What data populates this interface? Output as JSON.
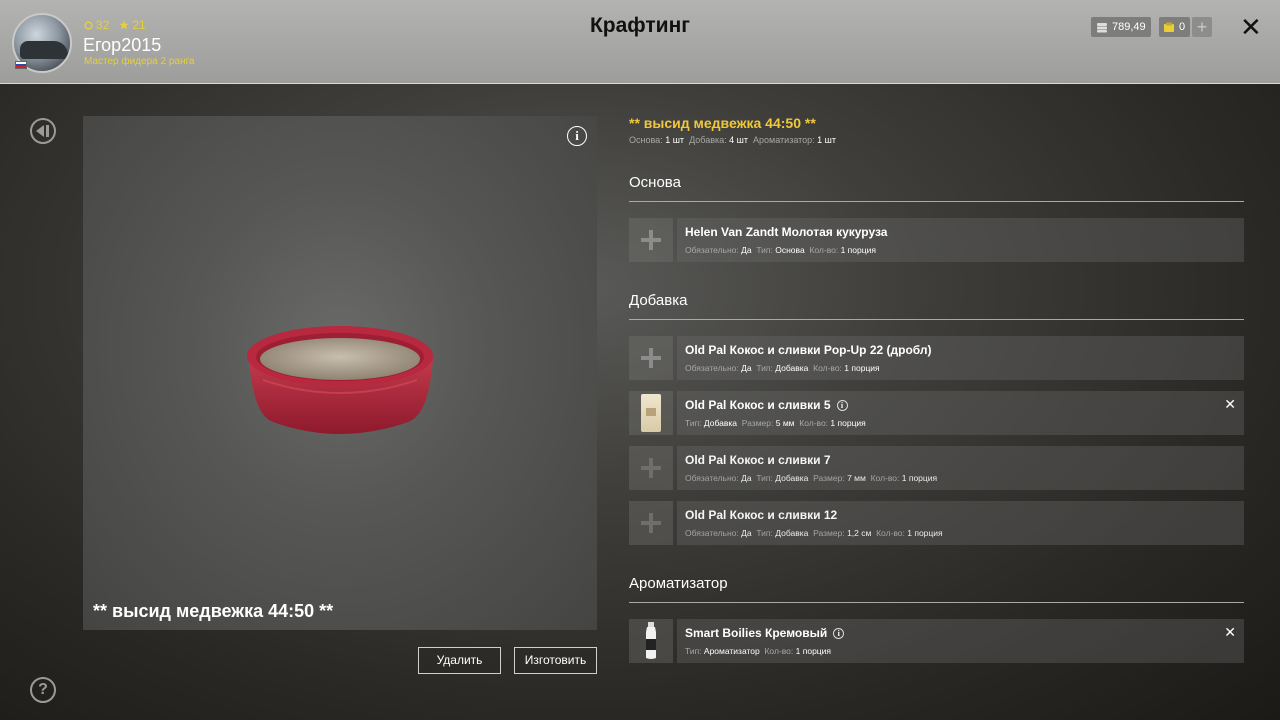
{
  "header": {
    "title": "Крафтинг",
    "username": "Егор2015",
    "rank": "Мастер фидера 2 ранга",
    "level": "32",
    "stars": "21",
    "money": "789,49",
    "gold": "0"
  },
  "preview": {
    "name": "** высид медвежка 44:50 **",
    "delete_label": "Удалить",
    "make_label": "Изготовить"
  },
  "recipe": {
    "title": "** высид медвежка 44:50 **",
    "summary": {
      "base_label": "Основа:",
      "base_value": "1 шт",
      "additive_label": "Добавка:",
      "additive_value": "4 шт",
      "flavor_label": "Ароматизатор:",
      "flavor_value": "1 шт"
    }
  },
  "sections": {
    "base": {
      "title": "Основа",
      "items": [
        {
          "name": "Helen Van Zandt Молотая кукуруза",
          "req_label": "Обязательно:",
          "req": "Да",
          "type_label": "Тип:",
          "type": "Основа",
          "qty_label": "Кол-во:",
          "qty": "1 порция"
        }
      ]
    },
    "additive": {
      "title": "Добавка",
      "items": [
        {
          "name": "Old Pal Кокос и сливки Pop-Up 22 (дробл)",
          "req_label": "Обязательно:",
          "req": "Да",
          "type_label": "Тип:",
          "type": "Добавка",
          "qty_label": "Кол-во:",
          "qty": "1 порция"
        },
        {
          "name": "Old Pal Кокос и сливки 5",
          "type_label": "Тип:",
          "type": "Добавка",
          "size_label": "Размер:",
          "size": "5 мм",
          "qty_label": "Кол-во:",
          "qty": "1 порция"
        },
        {
          "name": "Old Pal Кокос и сливки 7",
          "req_label": "Обязательно:",
          "req": "Да",
          "type_label": "Тип:",
          "type": "Добавка",
          "size_label": "Размер:",
          "size": "7 мм",
          "qty_label": "Кол-во:",
          "qty": "1 порция"
        },
        {
          "name": "Old Pal Кокос и сливки 12",
          "req_label": "Обязательно:",
          "req": "Да",
          "type_label": "Тип:",
          "type": "Добавка",
          "size_label": "Размер:",
          "size": "1,2 см",
          "qty_label": "Кол-во:",
          "qty": "1 порция"
        }
      ]
    },
    "flavor": {
      "title": "Ароматизатор",
      "items": [
        {
          "name": "Smart Boilies Кремовый",
          "type_label": "Тип:",
          "type": "Ароматизатор",
          "qty_label": "Кол-во:",
          "qty": "1 порция"
        }
      ]
    }
  },
  "icons": {
    "close": "close-icon",
    "back": "back-arrow-icon",
    "help": "help-icon",
    "info": "info-icon",
    "add": "plus-icon",
    "remove": "remove-x-icon"
  },
  "colors": {
    "accent_yellow": "#f0c83a",
    "bowl_red": "#b8283e",
    "header_bg": "#a9a9a7"
  }
}
